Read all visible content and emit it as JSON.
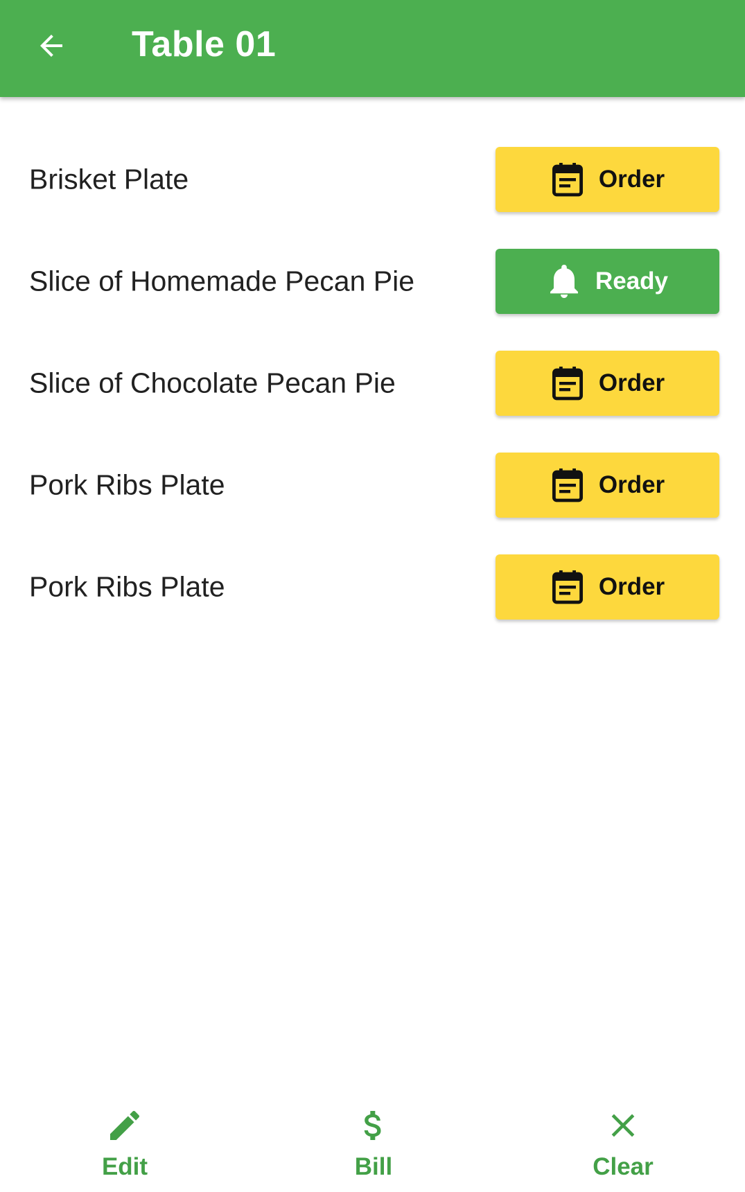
{
  "appbar": {
    "title": "Table 01",
    "back_icon": "arrow-left-icon"
  },
  "colors": {
    "primary": "#4caf50",
    "order_button": "#fdd83d",
    "ready_button": "#4caf50",
    "nav_accent": "#43a047"
  },
  "items": [
    {
      "name": "Brisket Plate",
      "status": "Order",
      "icon": "calendar-note-icon"
    },
    {
      "name": "Slice of Homemade Pecan Pie",
      "status": "Ready",
      "icon": "bell-icon"
    },
    {
      "name": "Slice of Chocolate Pecan Pie",
      "status": "Order",
      "icon": "calendar-note-icon"
    },
    {
      "name": "Pork Ribs Plate",
      "status": "Order",
      "icon": "calendar-note-icon"
    },
    {
      "name": "Pork Ribs Plate",
      "status": "Order",
      "icon": "calendar-note-icon"
    }
  ],
  "bottom_nav": {
    "edit_label": "Edit",
    "bill_label": "Bill",
    "clear_label": "Clear"
  }
}
